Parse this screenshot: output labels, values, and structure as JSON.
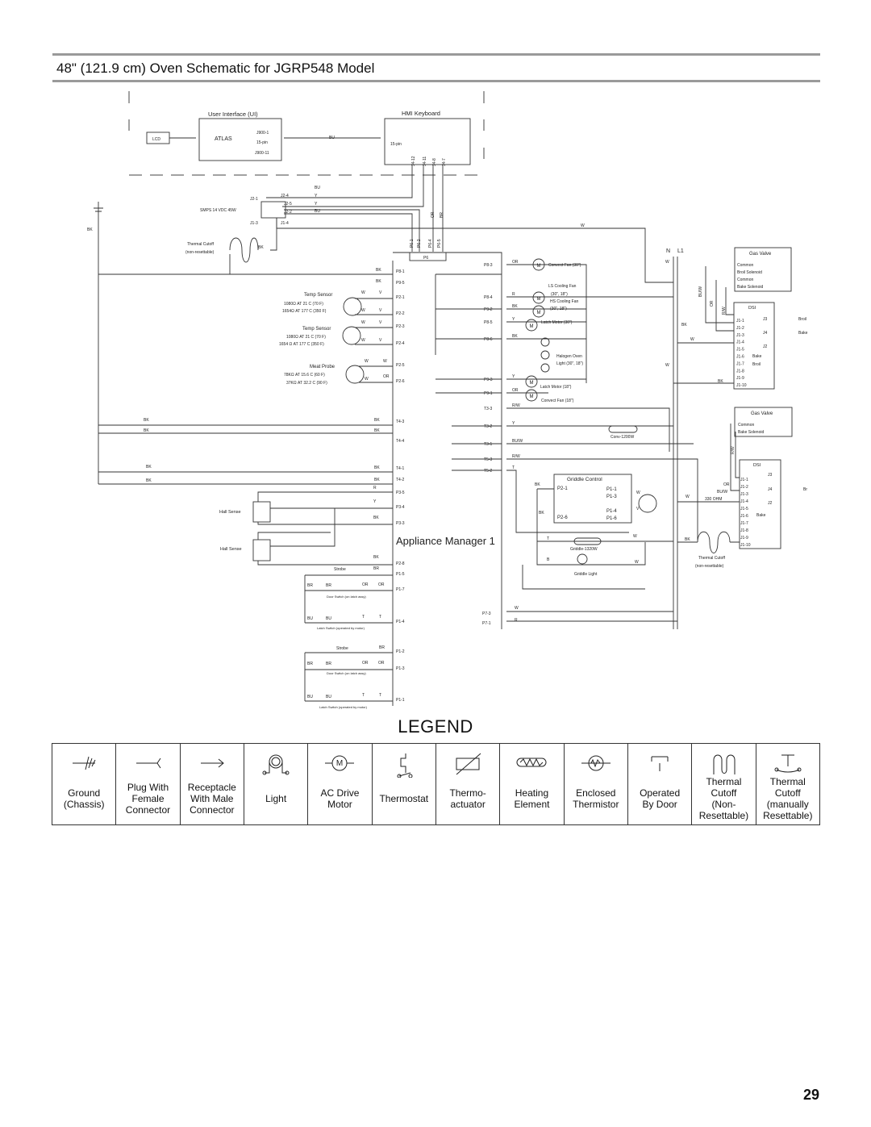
{
  "title": "48\" (121.9 cm) Oven Schematic for JGRP548 Model",
  "schematic": {
    "ui": {
      "title": "User Interface (UI)",
      "lcd": "LCD",
      "atlas": "ATLAS",
      "j900_1": "J900-1",
      "pin": "15-pin",
      "j900_11": "J900-11"
    },
    "hmi": {
      "title": "HMI Keyboard",
      "pin": "15-pin",
      "pins": [
        "J4-12",
        "J4-11",
        "J4-8",
        "J4-7"
      ]
    },
    "bus_wire": "BU",
    "smps": {
      "label": "SMPS 14 VDC 45W",
      "pins": [
        "J2-1",
        "J2-4",
        "J2-5",
        "J2-2",
        "J1-3",
        "J1-4"
      ],
      "wires": [
        "BU",
        "Y",
        "Y",
        "BU",
        "OR",
        "BR"
      ]
    },
    "p6": {
      "label": "P6",
      "pins": [
        "P6-1",
        "P6-2",
        "P6-4",
        "P6-5"
      ]
    },
    "thermal_cutoff_top": {
      "label": "Thermal Cutoff",
      "sub": "(non-resettable)",
      "wire": "BK"
    },
    "ground_wire": "BK",
    "supply": {
      "n": "N",
      "l1": "L1"
    },
    "appliance_manager": "Appliance Manager 1",
    "left_ports": [
      "P8-1",
      "P9-5",
      "P2-1",
      "P2-2",
      "P2-3",
      "P2-4",
      "P2-5",
      "P2-6",
      "T4-3",
      "T4-4",
      "T4-1",
      "T4-2",
      "P3-5",
      "P3-4",
      "P3-3",
      "P2-8",
      "P1-5",
      "P1-7",
      "P1-4",
      "P1-2",
      "P1-3",
      "P1-1"
    ],
    "left_wires": [
      "BK",
      "BK",
      "BK",
      "BK",
      "BK",
      "BK",
      "BK",
      "BK",
      "BK",
      "BK",
      "BK",
      "BK",
      "R",
      "Y",
      "BK",
      "BK",
      "BR",
      "BR"
    ],
    "temp_sensor_1": {
      "label": "Temp Sensor",
      "spec1": "1080Ω AT 21 C (70 F)",
      "spec2": "1654Ω AT 177 C (350 F)",
      "wires": [
        "W",
        "V",
        "W",
        "V"
      ]
    },
    "temp_sensor_2": {
      "label": "Temp Sensor",
      "spec1": "1080Ω AT 21 C (70 F)",
      "spec2": "1654 Ω AT 177 C (350 F)",
      "wires": [
        "W",
        "V",
        "W",
        "V"
      ]
    },
    "meat_probe": {
      "label": "Meat Probe",
      "spec1": "78KΩ AT 15.6 C (60 F)",
      "spec2": "37KΩ AT 32.2 C (90 F)",
      "wires": [
        "W",
        "W",
        "W",
        "OR"
      ]
    },
    "hall_sense": [
      "Hall Sense",
      "Hall Sense"
    ],
    "door_group_1": {
      "strobe": "Strobe",
      "door_switch": "Door Switch (on latch assy)",
      "latch_switch": "Latch Switch (operated by motor)",
      "wires": [
        "BR",
        "BR",
        "OR",
        "OR",
        "BU",
        "BU",
        "T",
        "T"
      ]
    },
    "door_group_2": {
      "strobe": "Strobe",
      "strobe_wire": "BR",
      "door_switch": "Door Switch (on latch assy)",
      "latch_switch": "Latch Switch (operated by motor)",
      "wires": [
        "BR",
        "BR",
        "OR",
        "OR",
        "BU",
        "BU",
        "T",
        "T"
      ]
    },
    "right_ports": [
      "P8-3",
      "P8-4",
      "P9-2",
      "P8-5",
      "P8-6",
      "P9-3",
      "P9-1",
      "T3-3",
      "T3-2",
      "T3-1",
      "T5-3",
      "T5-2"
    ],
    "right_wires": [
      "OR",
      "R",
      "BK",
      "Y",
      "BK",
      "Y",
      "OR",
      "R/W",
      "Y",
      "BU/W",
      "R/W",
      "T"
    ],
    "loads": {
      "convect_fan_30": "Convect Fan (30\")",
      "ls_cooling_fan": "LS Cooling Fan",
      "ls_sizes": "(30\", 18\")",
      "hs_cooling_fan": "HS Cooling Fan",
      "hs_sizes": "(30\", 18\")",
      "latch_motor_30": "Latch Motor (30\")",
      "halogen": "Halogen Oven",
      "halogen_sizes": "Light (30\", 18\")",
      "latch_motor_18": "Latch Motor (18\")",
      "convect_fan_18": "Convect Fan (18\")",
      "conv_element": "Conv-1200W"
    },
    "motor_letter": "M",
    "w_labels": [
      "W",
      "W",
      "W",
      "W",
      "W"
    ],
    "bk_labels": [
      "BK",
      "BK",
      "BK"
    ],
    "gas_valve_1": {
      "title": "Gas Valve",
      "terminals": [
        "Common",
        "Broil Solenoid",
        "Common",
        "Bake Solenoid"
      ],
      "wires": [
        "BU/W",
        "OR",
        "R/W"
      ]
    },
    "dsi_1": {
      "title": "DSI",
      "pins": [
        "J1-1",
        "J1-2",
        "J1-3",
        "J1-4",
        "J1-5",
        "J1-6",
        "J1-7",
        "J1-8",
        "J1-9",
        "J1-10"
      ],
      "outputs": [
        "J3",
        "J4",
        "J2"
      ],
      "output_labels": [
        "Broil",
        "Bake"
      ],
      "inner": [
        "Bake",
        "Broil"
      ]
    },
    "gas_valve_2": {
      "title": "Gas Valve",
      "terminals": [
        "Common",
        "Bake Solenoid"
      ],
      "wires": [
        "R/W",
        "OR",
        "BU/W"
      ],
      "resistor": "330 OHM"
    },
    "dsi_2": {
      "title": "DSI",
      "pins": [
        "J1-1",
        "J1-2",
        "J1-3",
        "J1-4",
        "J1-5",
        "J1-6",
        "J1-7",
        "J1-8",
        "J1-9",
        "J1-10"
      ],
      "outputs": [
        "J3",
        "J4",
        "J2"
      ],
      "output_labels": [
        "Br"
      ],
      "inner": [
        "Bake"
      ]
    },
    "thermal_cutoff_bottom": {
      "label": "Thermal Cutoff",
      "sub": "(non-resettable)"
    },
    "griddle_control": {
      "title": "Griddle Control",
      "pins_left": [
        "P2-1",
        "P2-6"
      ],
      "pins_right": [
        "P1-1",
        "P1-3",
        "P1-4",
        "P1-6"
      ],
      "wires": [
        "BK",
        "BK",
        "W",
        "V",
        "T",
        "W",
        "B",
        "W"
      ],
      "element": "Griddle-1320W",
      "light": "Griddle Light"
    },
    "p7": {
      "ports": [
        "P7-3",
        "P7-1"
      ],
      "wires": [
        "W",
        "R"
      ]
    }
  },
  "legend": {
    "title": "LEGEND",
    "items": [
      {
        "icon": "ground-icon",
        "lines": [
          "Ground",
          "(Chassis)"
        ]
      },
      {
        "icon": "plug-female-icon",
        "lines": [
          "Plug With",
          "Female",
          "Connector"
        ]
      },
      {
        "icon": "receptacle-male-icon",
        "lines": [
          "Receptacle",
          "With Male",
          "Connector"
        ]
      },
      {
        "icon": "light-icon",
        "lines": [
          "Light"
        ]
      },
      {
        "icon": "motor-icon",
        "lines": [
          "AC Drive",
          "Motor"
        ]
      },
      {
        "icon": "thermostat-icon",
        "lines": [
          "Thermostat"
        ]
      },
      {
        "icon": "thermo-actuator-icon",
        "lines": [
          "Thermo-",
          "actuator"
        ]
      },
      {
        "icon": "heating-element-icon",
        "lines": [
          "Heating",
          "Element"
        ]
      },
      {
        "icon": "thermistor-icon",
        "lines": [
          "Enclosed",
          "Thermistor"
        ]
      },
      {
        "icon": "door-operated-icon",
        "lines": [
          "Operated",
          "By Door"
        ]
      },
      {
        "icon": "thermal-cutoff-icon",
        "lines": [
          "Thermal Cutoff",
          "(Non-",
          "Resettable)"
        ]
      },
      {
        "icon": "thermal-cutoff-manual-icon",
        "lines": [
          "Thermal Cutoff",
          "(manually",
          "Resettable)"
        ]
      }
    ]
  },
  "page_number": "29"
}
